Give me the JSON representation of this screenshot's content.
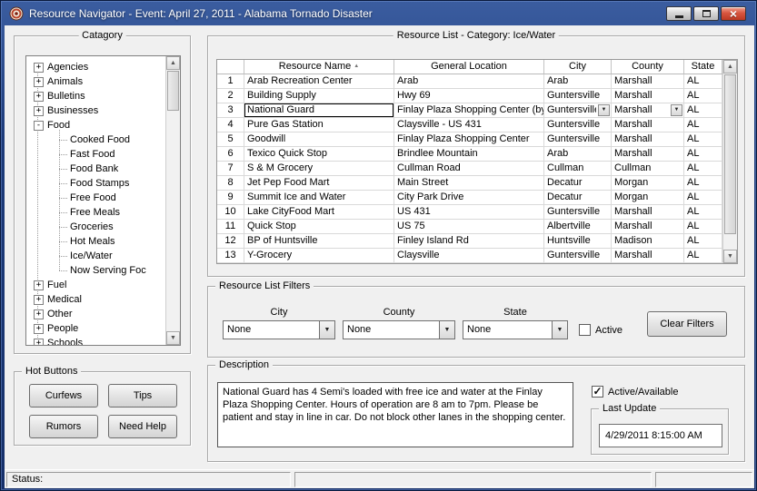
{
  "window": {
    "title": "Resource Navigator - Event: April 27, 2011 - Alabama Tornado Disaster"
  },
  "icons": {
    "scroll_up": "▲",
    "scroll_down": "▼",
    "dropdown_arrow": "▼",
    "sort_asc": "▲",
    "check": "✓",
    "close": "×"
  },
  "colors": {
    "titlebar": "#1d3b7a",
    "close_button": "#bc3822",
    "client_bg": "#f0f0f0",
    "current_cell_border": "#000000"
  },
  "category_panel": {
    "title": "Catagory",
    "items": [
      {
        "label": "Agencies",
        "glyph": "+"
      },
      {
        "label": "Animals",
        "glyph": "+"
      },
      {
        "label": "Bulletins",
        "glyph": "+"
      },
      {
        "label": "Businesses",
        "glyph": "+"
      },
      {
        "label": "Food",
        "glyph": "-"
      },
      {
        "label": "Cooked Food",
        "glyph": ""
      },
      {
        "label": "Fast Food",
        "glyph": ""
      },
      {
        "label": "Food Bank",
        "glyph": ""
      },
      {
        "label": "Food Stamps",
        "glyph": ""
      },
      {
        "label": "Free Food",
        "glyph": ""
      },
      {
        "label": "Free Meals",
        "glyph": ""
      },
      {
        "label": "Groceries",
        "glyph": ""
      },
      {
        "label": "Hot Meals",
        "glyph": ""
      },
      {
        "label": "Ice/Water",
        "glyph": ""
      },
      {
        "label": "Now Serving Foc",
        "glyph": ""
      },
      {
        "label": "Fuel",
        "glyph": "+"
      },
      {
        "label": "Medical",
        "glyph": "+"
      },
      {
        "label": "Other",
        "glyph": "+"
      },
      {
        "label": "People",
        "glyph": "+"
      },
      {
        "label": "Schools",
        "glyph": "+"
      }
    ]
  },
  "hot_buttons": {
    "title": "Hot Buttons",
    "buttons": [
      "Curfews",
      "Tips",
      "Rumors",
      "Need Help"
    ]
  },
  "resource_list": {
    "title": "Resource List - Category: Ice/Water",
    "columns": [
      "Resource Name",
      "General Location",
      "City",
      "County",
      "State"
    ],
    "rows": [
      {
        "num": "1",
        "name": "Arab Recreation Center",
        "location": "Arab",
        "city": "Arab",
        "county": "Marshall",
        "state": "AL"
      },
      {
        "num": "2",
        "name": "Building Supply",
        "location": "Hwy 69",
        "city": "Guntersville",
        "county": "Marshall",
        "state": "AL"
      },
      {
        "num": "3",
        "name": "National Guard",
        "location": "Finlay Plaza Shopping Center (by",
        "city": "Guntersville",
        "county": "Marshall",
        "state": "AL"
      },
      {
        "num": "4",
        "name": "Pure Gas Station",
        "location": "Claysville - US 431",
        "city": "Guntersville",
        "county": "Marshall",
        "state": "AL"
      },
      {
        "num": "5",
        "name": "Goodwill",
        "location": "Finlay Plaza Shopping Center",
        "city": "Guntersville",
        "county": "Marshall",
        "state": "AL"
      },
      {
        "num": "6",
        "name": "Texico Quick Stop",
        "location": "Brindlee Mountain",
        "city": "Arab",
        "county": "Marshall",
        "state": "AL"
      },
      {
        "num": "7",
        "name": "S & M Grocery",
        "location": "Cullman Road",
        "city": "Cullman",
        "county": "Cullman",
        "state": "AL"
      },
      {
        "num": "8",
        "name": "Jet Pep Food Mart",
        "location": "Main Street",
        "city": "Decatur",
        "county": "Morgan",
        "state": "AL"
      },
      {
        "num": "9",
        "name": "Summit Ice and Water",
        "location": "City Park Drive",
        "city": "Decatur",
        "county": "Morgan",
        "state": "AL"
      },
      {
        "num": "10",
        "name": "Lake CityFood Mart",
        "location": "US 431",
        "city": "Guntersville",
        "county": "Marshall",
        "state": "AL"
      },
      {
        "num": "11",
        "name": "Quick Stop",
        "location": "US 75",
        "city": "Albertville",
        "county": "Marshall",
        "state": "AL"
      },
      {
        "num": "12",
        "name": "BP of Huntsville",
        "location": "Finley Island Rd",
        "city": "Huntsville",
        "county": "Madison",
        "state": "AL"
      },
      {
        "num": "13",
        "name": "Y-Grocery",
        "location": "Claysville",
        "city": "Guntersville",
        "county": "Marshall",
        "state": "AL"
      }
    ]
  },
  "filters": {
    "title": "Resource List Filters",
    "city_label": "City",
    "county_label": "County",
    "state_label": "State",
    "city_value": "None",
    "county_value": "None",
    "state_value": "None",
    "active_label": "Active",
    "clear_button": "Clear Filters"
  },
  "description": {
    "title": "Description",
    "text": "National Guard has 4 Semi's loaded with free ice and water at the Finlay Plaza Shopping Center.  Hours of operation are 8 am to 7pm.  Please be patient and stay in line in car.  Do not block other lanes in the shopping center.",
    "active_label": "Active/Available",
    "last_update_title": "Last Update",
    "last_update_value": "4/29/2011 8:15:00 AM"
  },
  "status_bar": {
    "label": "Status:"
  }
}
